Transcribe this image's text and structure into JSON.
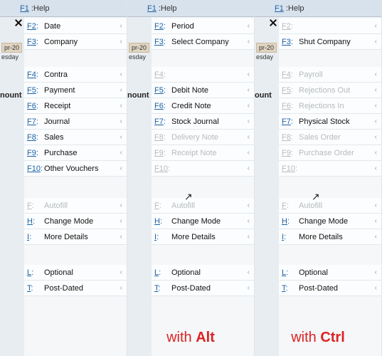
{
  "columns": [
    {
      "id": "default",
      "header": {
        "key": "F1",
        "label": "Help"
      },
      "show_close": true,
      "show_date": true,
      "date": "pr-20",
      "day": "esday",
      "ount": "nount",
      "caption": null,
      "groups": [
        [
          {
            "key": "F2",
            "ukey": "F2",
            "label": "Date",
            "disabled": false,
            "chev": true
          },
          {
            "key": "F3",
            "ukey": "F3",
            "label": "Company",
            "disabled": false,
            "chev": true
          }
        ],
        [
          {
            "key": "F4",
            "ukey": "F4",
            "label": "Contra",
            "disabled": false,
            "chev": true
          },
          {
            "key": "F5",
            "ukey": "F5",
            "label": "Payment",
            "disabled": false,
            "chev": true
          },
          {
            "key": "F6",
            "ukey": "F6",
            "label": "Receipt",
            "disabled": false,
            "chev": true
          },
          {
            "key": "F7",
            "ukey": "F7",
            "label": "Journal",
            "disabled": false,
            "chev": true
          },
          {
            "key": "F8",
            "ukey": "F8",
            "label": "Sales",
            "disabled": false,
            "chev": true
          },
          {
            "key": "F9",
            "ukey": "F9",
            "label": "Purchase",
            "disabled": false,
            "chev": true
          },
          {
            "key": "F10",
            "ukey": "F10",
            "label": "Other Vouchers",
            "disabled": false,
            "chev": true
          }
        ],
        [
          {
            "key": "F",
            "ukey": "F",
            "label": "Autofill",
            "disabled": true,
            "chev": true
          },
          {
            "key": "H",
            "ukey": "H",
            "label": "Change Mode",
            "disabled": false,
            "chev": true
          },
          {
            "key": "I",
            "ukey": "I",
            "label": "More Details",
            "disabled": false,
            "chev": true
          }
        ],
        [
          {
            "key": "L",
            "ukey": "L",
            "label": "Optional",
            "disabled": false,
            "chev": true
          },
          {
            "key": "T",
            "ukey": "T",
            "label": "Post-Dated",
            "disabled": false,
            "chev": true
          }
        ]
      ]
    },
    {
      "id": "alt",
      "header": {
        "key": "F1",
        "label": "Help"
      },
      "show_close": false,
      "show_date": true,
      "date": "pr-20",
      "day": "esday",
      "ount": "nount",
      "caption": {
        "prefix": "with ",
        "bold": "Alt"
      },
      "cursor": true,
      "groups": [
        [
          {
            "key": "F2",
            "ukey": "F2",
            "label": "Period",
            "disabled": false,
            "chev": true
          },
          {
            "key": "F3",
            "ukey": "F3",
            "label": "Select Company",
            "disabled": false,
            "chev": true
          }
        ],
        [
          {
            "key": "F4",
            "ukey": "F4",
            "label": "",
            "disabled": true,
            "chev": true
          },
          {
            "key": "F5",
            "ukey": "F5",
            "label": "Debit Note",
            "disabled": false,
            "chev": true
          },
          {
            "key": "F6",
            "ukey": "F6",
            "label": "Credit Note",
            "disabled": false,
            "chev": true
          },
          {
            "key": "F7",
            "ukey": "F7",
            "label": "Stock Journal",
            "disabled": false,
            "chev": true
          },
          {
            "key": "F8",
            "ukey": "F8",
            "label": "Delivery Note",
            "disabled": true,
            "chev": true
          },
          {
            "key": "F9",
            "ukey": "F9",
            "label": "Receipt Note",
            "disabled": true,
            "chev": true
          },
          {
            "key": "F10",
            "ukey": "F10",
            "label": "",
            "disabled": true,
            "chev": true
          }
        ],
        [
          {
            "key": "F",
            "ukey": "F",
            "label": "Autofill",
            "disabled": true,
            "chev": true
          },
          {
            "key": "H",
            "ukey": "H",
            "label": "Change Mode",
            "disabled": false,
            "chev": true
          },
          {
            "key": "I",
            "ukey": "I",
            "label": "More Details",
            "disabled": false,
            "chev": true
          }
        ],
        [
          {
            "key": "L",
            "ukey": "L",
            "label": "Optional",
            "disabled": false,
            "chev": true
          },
          {
            "key": "T",
            "ukey": "T",
            "label": "Post-Dated",
            "disabled": false,
            "chev": true
          }
        ]
      ]
    },
    {
      "id": "ctrl",
      "header": {
        "key": "F1",
        "label": "Help"
      },
      "show_close": true,
      "show_date": true,
      "date": "pr-20",
      "day": "esday",
      "ount": "ount",
      "caption": {
        "prefix": "with ",
        "bold": "Ctrl"
      },
      "cursor": true,
      "groups": [
        [
          {
            "key": "F2",
            "ukey": "F2",
            "label": "",
            "disabled": true,
            "chev": true
          },
          {
            "key": "F3",
            "ukey": "F3",
            "label": "Shut Company",
            "disabled": false,
            "chev": true
          }
        ],
        [
          {
            "key": "F4",
            "ukey": "F4",
            "label": "Payroll",
            "disabled": true,
            "chev": true
          },
          {
            "key": "F5",
            "ukey": "F5",
            "label": "Rejections Out",
            "disabled": true,
            "chev": true
          },
          {
            "key": "F6",
            "ukey": "F6",
            "label": "Rejections In",
            "disabled": true,
            "chev": true
          },
          {
            "key": "F7",
            "ukey": "F7",
            "label": "Physical Stock",
            "disabled": false,
            "chev": true
          },
          {
            "key": "F8",
            "ukey": "F8",
            "label": "Sales Order",
            "disabled": true,
            "chev": true
          },
          {
            "key": "F9",
            "ukey": "F9",
            "label": "Purchase Order",
            "disabled": true,
            "chev": true
          },
          {
            "key": "F10",
            "ukey": "F10",
            "label": "",
            "disabled": true,
            "chev": true
          }
        ],
        [
          {
            "key": "F",
            "ukey": "F",
            "label": "Autofill",
            "disabled": true,
            "chev": true
          },
          {
            "key": "H",
            "ukey": "H",
            "label": "Change Mode",
            "disabled": false,
            "chev": true
          },
          {
            "key": "I",
            "ukey": "I",
            "label": "More Details",
            "disabled": false,
            "chev": true
          }
        ],
        [
          {
            "key": "L",
            "ukey": "L",
            "label": "Optional",
            "disabled": false,
            "chev": true
          },
          {
            "key": "T",
            "ukey": "T",
            "label": "Post-Dated",
            "disabled": false,
            "chev": true
          }
        ]
      ]
    }
  ]
}
